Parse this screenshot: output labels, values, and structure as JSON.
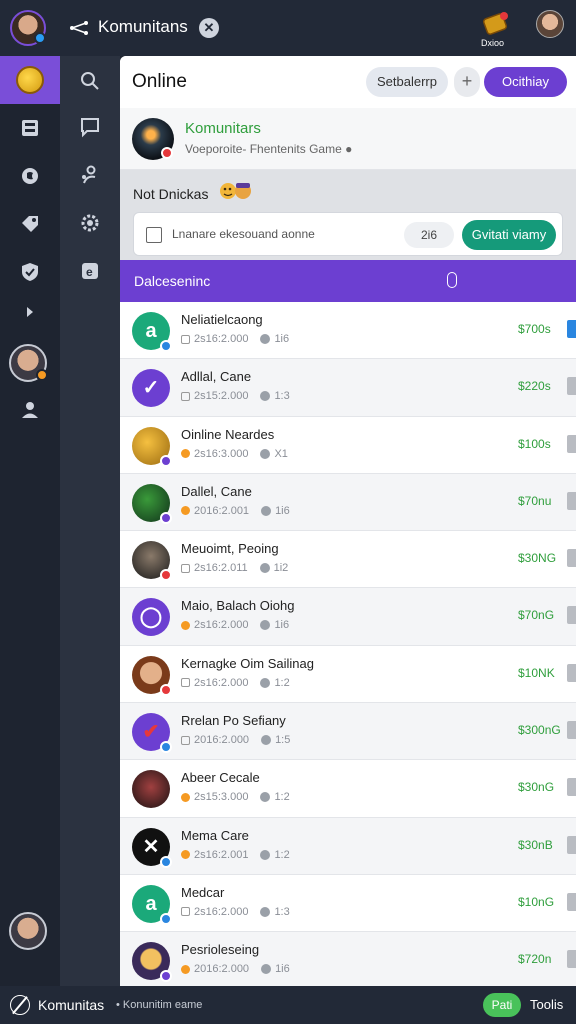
{
  "topbar": {
    "app_name": "Komunitans",
    "close_glyph": "✕",
    "coins_label": "Dxioo",
    "icons": [
      "share-icon",
      "close-icon",
      "coins-icon",
      "profile-icon"
    ]
  },
  "rail": {
    "items": [
      "coin-icon",
      "inbox-icon",
      "discord-icon",
      "tag-icon",
      "shield-icon",
      "expand-icon",
      "user-icon"
    ]
  },
  "subrail": {
    "items": [
      "search-icon",
      "chat-icon",
      "users-icon",
      "settings-icon",
      "e-icon"
    ]
  },
  "panel": {
    "title": "Online",
    "btn_light": "Setbalerrp",
    "btn_plus": "+",
    "btn_purple": "Ocithiay"
  },
  "community": {
    "name": "Komunitars",
    "subtitle": "Voeporoite- Fhentenits Game ●"
  },
  "notdock": {
    "label": "Not Dnickas",
    "search_placeholder": "Lnanare ekesouand aonne",
    "count": "2i6",
    "go_label": "Gvitati viamy"
  },
  "section": {
    "title": "Dalceseninc"
  },
  "rows": [
    {
      "name": "Neliatielcaong",
      "meta": "2s16:2.000",
      "stat": "1i6",
      "price": "$700s",
      "tag": "blue"
    },
    {
      "name": "Adllal, Cane",
      "meta": "2s15:2.000",
      "stat": "1:3",
      "price": "$220s",
      "tag": "gray"
    },
    {
      "name": "Oinline Neardes",
      "meta": "2s16:3.000",
      "stat": "X1",
      "price": "$100s",
      "tag": "gray"
    },
    {
      "name": "Dallel, Cane",
      "meta": "2016:2.001",
      "stat": "1i6",
      "price": "$70nu",
      "tag": "gray"
    },
    {
      "name": "Meuoimt, Peoing",
      "meta": "2s16:2.011",
      "stat": "1i2",
      "price": "$30NG",
      "tag": "gray"
    },
    {
      "name": "Maio, Balach Oiohg",
      "meta": "2s16:2.000",
      "stat": "1i6",
      "price": "$70nG",
      "tag": "gray"
    },
    {
      "name": "Kernagke Oim Sailinag",
      "meta": "2s16:2.000",
      "stat": "1:2",
      "price": "$10NK",
      "tag": "gray"
    },
    {
      "name": "Rrelan Po Sefiany",
      "meta": "2016:2.000",
      "stat": "1:5",
      "price": "$300nG",
      "tag": "gray"
    },
    {
      "name": "Abeer Cecale",
      "meta": "2s15:3.000",
      "stat": "1:2",
      "price": "$30nG",
      "tag": "gray"
    },
    {
      "name": "Mema Care",
      "meta": "2s16:2.001",
      "stat": "1:2",
      "price": "$30nB",
      "tag": "gray"
    },
    {
      "name": "Medcar",
      "meta": "2s16:2.000",
      "stat": "1:3",
      "price": "$10nG",
      "tag": "gray"
    },
    {
      "name": "Pesrioleseing",
      "meta": "2016:2.000",
      "stat": "1i6",
      "price": "$720n",
      "tag": "gray"
    }
  ],
  "bottombar": {
    "name": "Komunitas",
    "subtitle": "• Konunitim eame",
    "pill": "Pati",
    "tools": "Toolis"
  },
  "colors": {
    "accent_purple": "#6c3fd1",
    "accent_green": "#159a7a",
    "price_green": "#2f9e3c",
    "dark_bg": "#222937"
  }
}
